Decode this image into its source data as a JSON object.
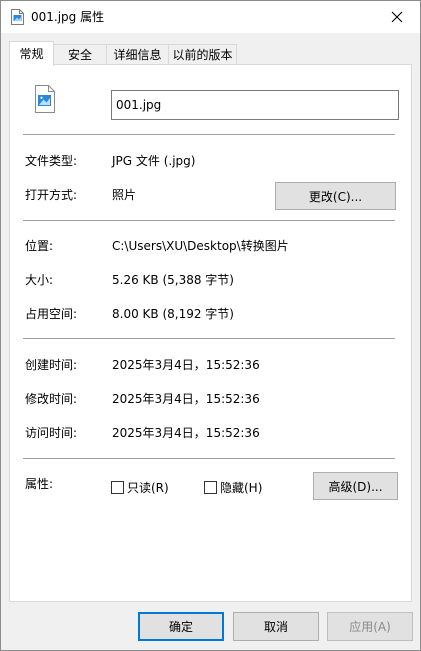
{
  "window": {
    "title": "001.jpg 属性"
  },
  "tabs": [
    {
      "label": "常规"
    },
    {
      "label": "安全"
    },
    {
      "label": "详细信息"
    },
    {
      "label": "以前的版本"
    }
  ],
  "general": {
    "file_name": "001.jpg",
    "file_type_label": "文件类型:",
    "file_type_value": "JPG 文件 (.jpg)",
    "open_with_label": "打开方式:",
    "open_with_value": "照片",
    "change_button": "更改(C)...",
    "location_label": "位置:",
    "location_value": "C:\\Users\\XU\\Desktop\\转换图片",
    "size_label": "大小:",
    "size_value": "5.26 KB (5,388 字节)",
    "size_on_disk_label": "占用空间:",
    "size_on_disk_value": "8.00 KB (8,192 字节)",
    "created_label": "创建时间:",
    "created_value": "2025年3月4日，15:52:36",
    "modified_label": "修改时间:",
    "modified_value": "2025年3月4日，15:52:36",
    "accessed_label": "访问时间:",
    "accessed_value": "2025年3月4日，15:52:36",
    "attributes_label": "属性:",
    "readonly_label": "只读(R)",
    "readonly_checked": false,
    "hidden_label": "隐藏(H)",
    "hidden_checked": false,
    "advanced_button": "高级(D)..."
  },
  "footer": {
    "ok_button": "确定",
    "cancel_button": "取消",
    "apply_button": "应用(A)"
  },
  "colors": {
    "accent": "#0078d7",
    "image_icon": "#2b88d8"
  }
}
